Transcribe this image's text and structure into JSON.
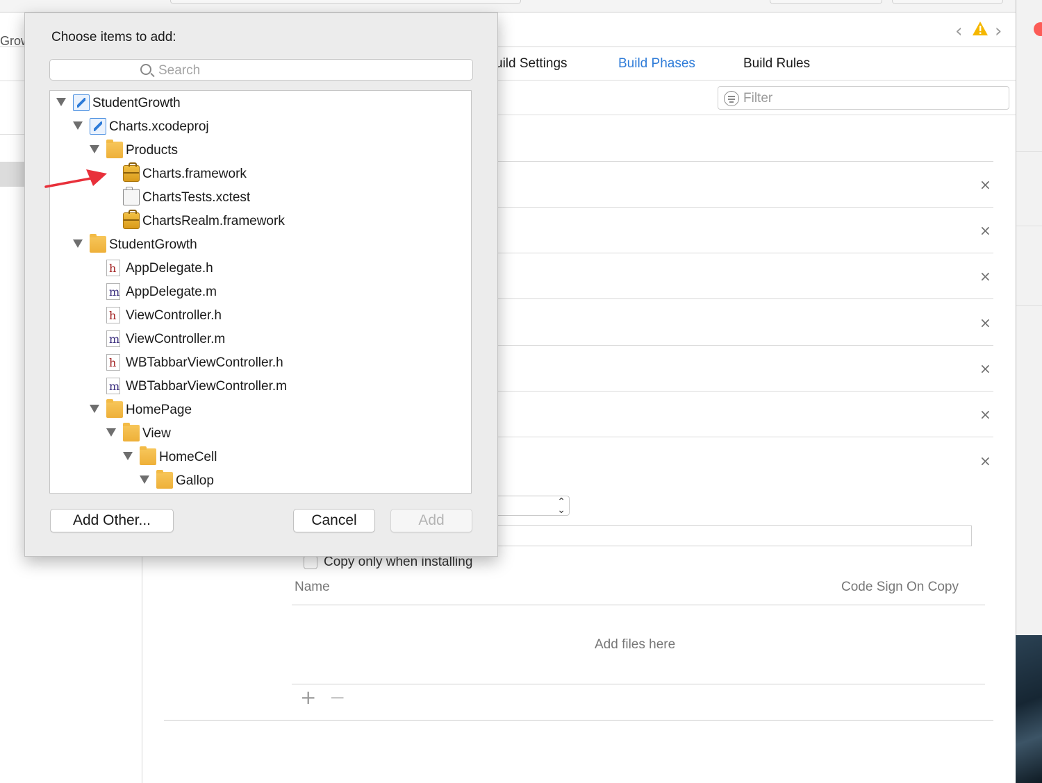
{
  "background_window": {
    "left_partial_label": "Grow",
    "tabs": [
      {
        "label": "uild Settings",
        "active": false
      },
      {
        "label": "Build Phases",
        "active": true
      },
      {
        "label": "Build Rules",
        "active": false
      }
    ],
    "filter_placeholder": "Filter",
    "row_close_glyph": "×",
    "copy_only_label": "Copy only when installing",
    "columns": {
      "name": "Name",
      "code_sign": "Code Sign On Copy"
    },
    "empty_hint": "Add files here",
    "add_glyph": "+",
    "remove_glyph": "−",
    "accent_color": "#2f7cd8",
    "warning_color": "#f5b700"
  },
  "sheet": {
    "title": "Choose items to add:",
    "search_placeholder": "Search",
    "tree": [
      {
        "label": "StudentGrowth",
        "icon": "xcode-project-icon",
        "expanded": true,
        "depth": 0
      },
      {
        "label": "Charts.xcodeproj",
        "icon": "xcode-project-icon",
        "expanded": true,
        "depth": 1
      },
      {
        "label": "Products",
        "icon": "folder-icon",
        "expanded": true,
        "depth": 2
      },
      {
        "label": "Charts.framework",
        "icon": "framework-icon",
        "depth": 3,
        "annotated": true
      },
      {
        "label": "ChartsTests.xctest",
        "icon": "test-bundle-icon",
        "depth": 3
      },
      {
        "label": "ChartsRealm.framework",
        "icon": "framework-icon",
        "depth": 3
      },
      {
        "label": "StudentGrowth",
        "icon": "folder-icon",
        "expanded": true,
        "depth": 1
      },
      {
        "label": "AppDelegate.h",
        "icon": "header-file-icon",
        "glyph": "h",
        "depth": 2
      },
      {
        "label": "AppDelegate.m",
        "icon": "objc-file-icon",
        "glyph": "m",
        "depth": 2
      },
      {
        "label": "ViewController.h",
        "icon": "header-file-icon",
        "glyph": "h",
        "depth": 2
      },
      {
        "label": "ViewController.m",
        "icon": "objc-file-icon",
        "glyph": "m",
        "depth": 2
      },
      {
        "label": "WBTabbarViewController.h",
        "icon": "header-file-icon",
        "glyph": "h",
        "depth": 2
      },
      {
        "label": "WBTabbarViewController.m",
        "icon": "objc-file-icon",
        "glyph": "m",
        "depth": 2
      },
      {
        "label": "HomePage",
        "icon": "folder-icon",
        "expanded": true,
        "depth": 2
      },
      {
        "label": "View",
        "icon": "folder-icon",
        "expanded": true,
        "depth": 3
      },
      {
        "label": "HomeCell",
        "icon": "folder-icon",
        "expanded": true,
        "depth": 4
      },
      {
        "label": "Gallop",
        "icon": "folder-icon",
        "expanded": true,
        "depth": 5
      }
    ],
    "buttons": {
      "add_other": "Add Other...",
      "cancel": "Cancel",
      "add": "Add",
      "add_enabled": false
    },
    "annotation_arrow_color": "#e8303a"
  }
}
